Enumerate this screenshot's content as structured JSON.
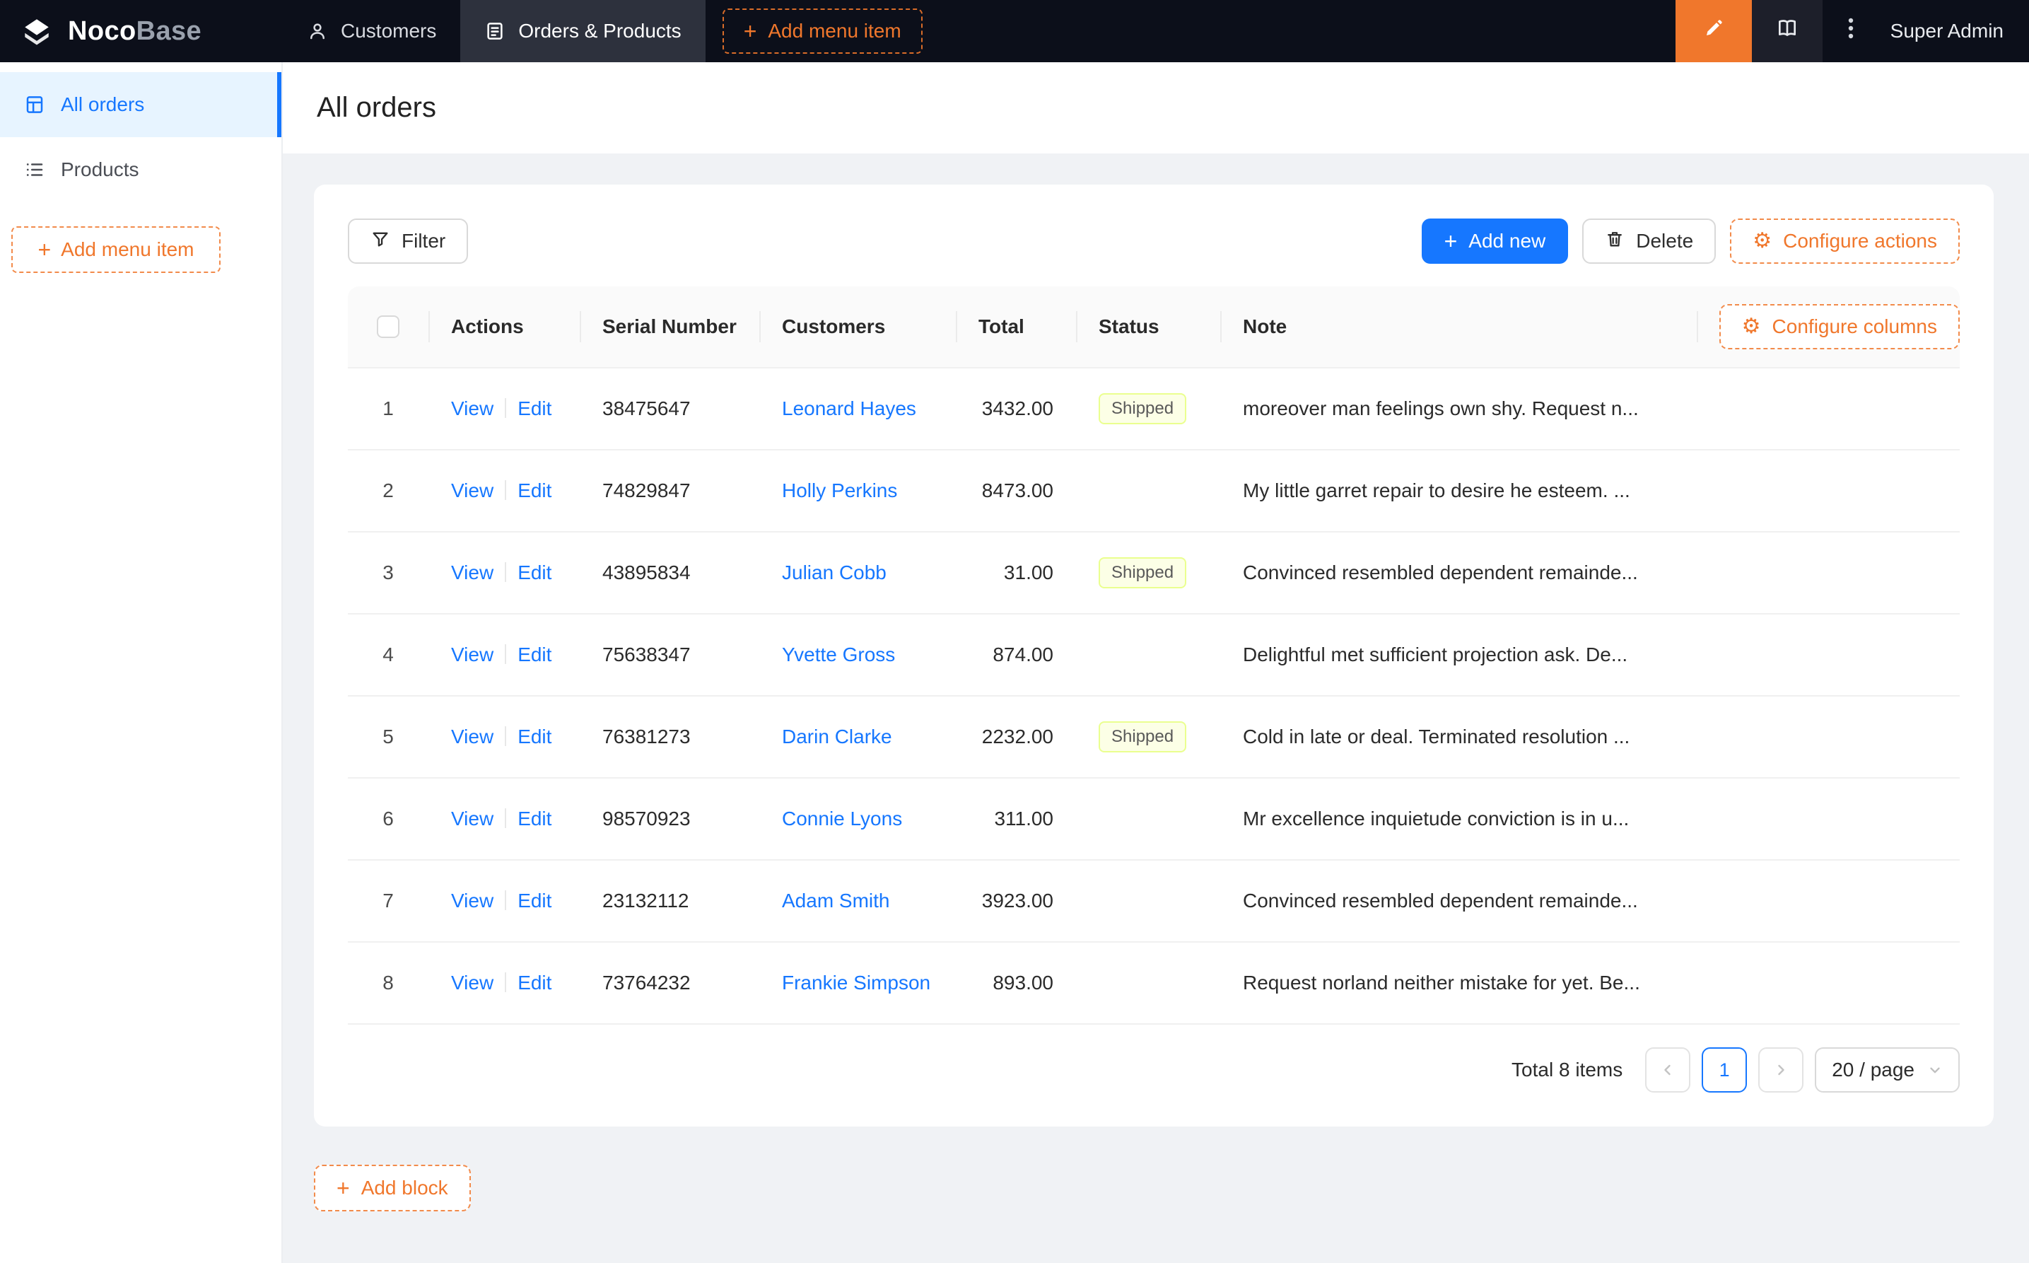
{
  "colors": {
    "accent_orange": "#f0772c",
    "primary_blue": "#1677ff",
    "header_bg": "#0c0f1a",
    "active_nav_bg": "#2d313d",
    "sidebar_active_bg": "#e7f4ff",
    "status_tag_bg": "#fcffe6",
    "status_tag_border": "#eaff8f",
    "content_bg": "#f0f2f5"
  },
  "header": {
    "logo_noco": "Noco",
    "logo_base": "Base",
    "nav": [
      {
        "label": "Customers"
      },
      {
        "label": "Orders & Products"
      }
    ],
    "add_menu_item": "Add menu item",
    "user_name": "Super Admin"
  },
  "sidebar": {
    "items": [
      {
        "label": "All orders"
      },
      {
        "label": "Products"
      }
    ],
    "add_menu_item": "Add menu item"
  },
  "page": {
    "title": "All orders"
  },
  "toolbar": {
    "filter": "Filter",
    "add_new": "Add new",
    "delete": "Delete",
    "configure_actions": "Configure actions"
  },
  "table": {
    "columns": {
      "actions": "Actions",
      "serial": "Serial Number",
      "customers": "Customers",
      "total": "Total",
      "status": "Status",
      "note": "Note"
    },
    "configure_columns": "Configure columns",
    "actions_labels": {
      "view": "View",
      "edit": "Edit"
    },
    "rows": [
      {
        "index": 1,
        "serial": "38475647",
        "customer": "Leonard Hayes",
        "total": "3432.00",
        "status": "Shipped",
        "note": "moreover man feelings own shy. Request n..."
      },
      {
        "index": 2,
        "serial": "74829847",
        "customer": "Holly Perkins",
        "total": "8473.00",
        "status": "",
        "note": "My little garret repair to desire he esteem. ..."
      },
      {
        "index": 3,
        "serial": "43895834",
        "customer": "Julian Cobb",
        "total": "31.00",
        "status": "Shipped",
        "note": "Convinced resembled dependent remainde..."
      },
      {
        "index": 4,
        "serial": "75638347",
        "customer": "Yvette Gross",
        "total": "874.00",
        "status": "",
        "note": "Delightful met sufficient projection ask. De..."
      },
      {
        "index": 5,
        "serial": "76381273",
        "customer": "Darin Clarke",
        "total": "2232.00",
        "status": "Shipped",
        "note": "Cold in late or deal. Terminated resolution ..."
      },
      {
        "index": 6,
        "serial": "98570923",
        "customer": "Connie Lyons",
        "total": "311.00",
        "status": "",
        "note": "Mr excellence inquietude conviction is in u..."
      },
      {
        "index": 7,
        "serial": "23132112",
        "customer": "Adam Smith",
        "total": "3923.00",
        "status": "",
        "note": "Convinced resembled dependent remainde..."
      },
      {
        "index": 8,
        "serial": "73764232",
        "customer": "Frankie Simpson",
        "total": "893.00",
        "status": "",
        "note": "Request norland neither mistake for yet. Be..."
      }
    ]
  },
  "pagination": {
    "total_text": "Total 8 items",
    "current_page": "1",
    "page_size": "20 / page"
  },
  "footer": {
    "add_block": "Add block"
  }
}
